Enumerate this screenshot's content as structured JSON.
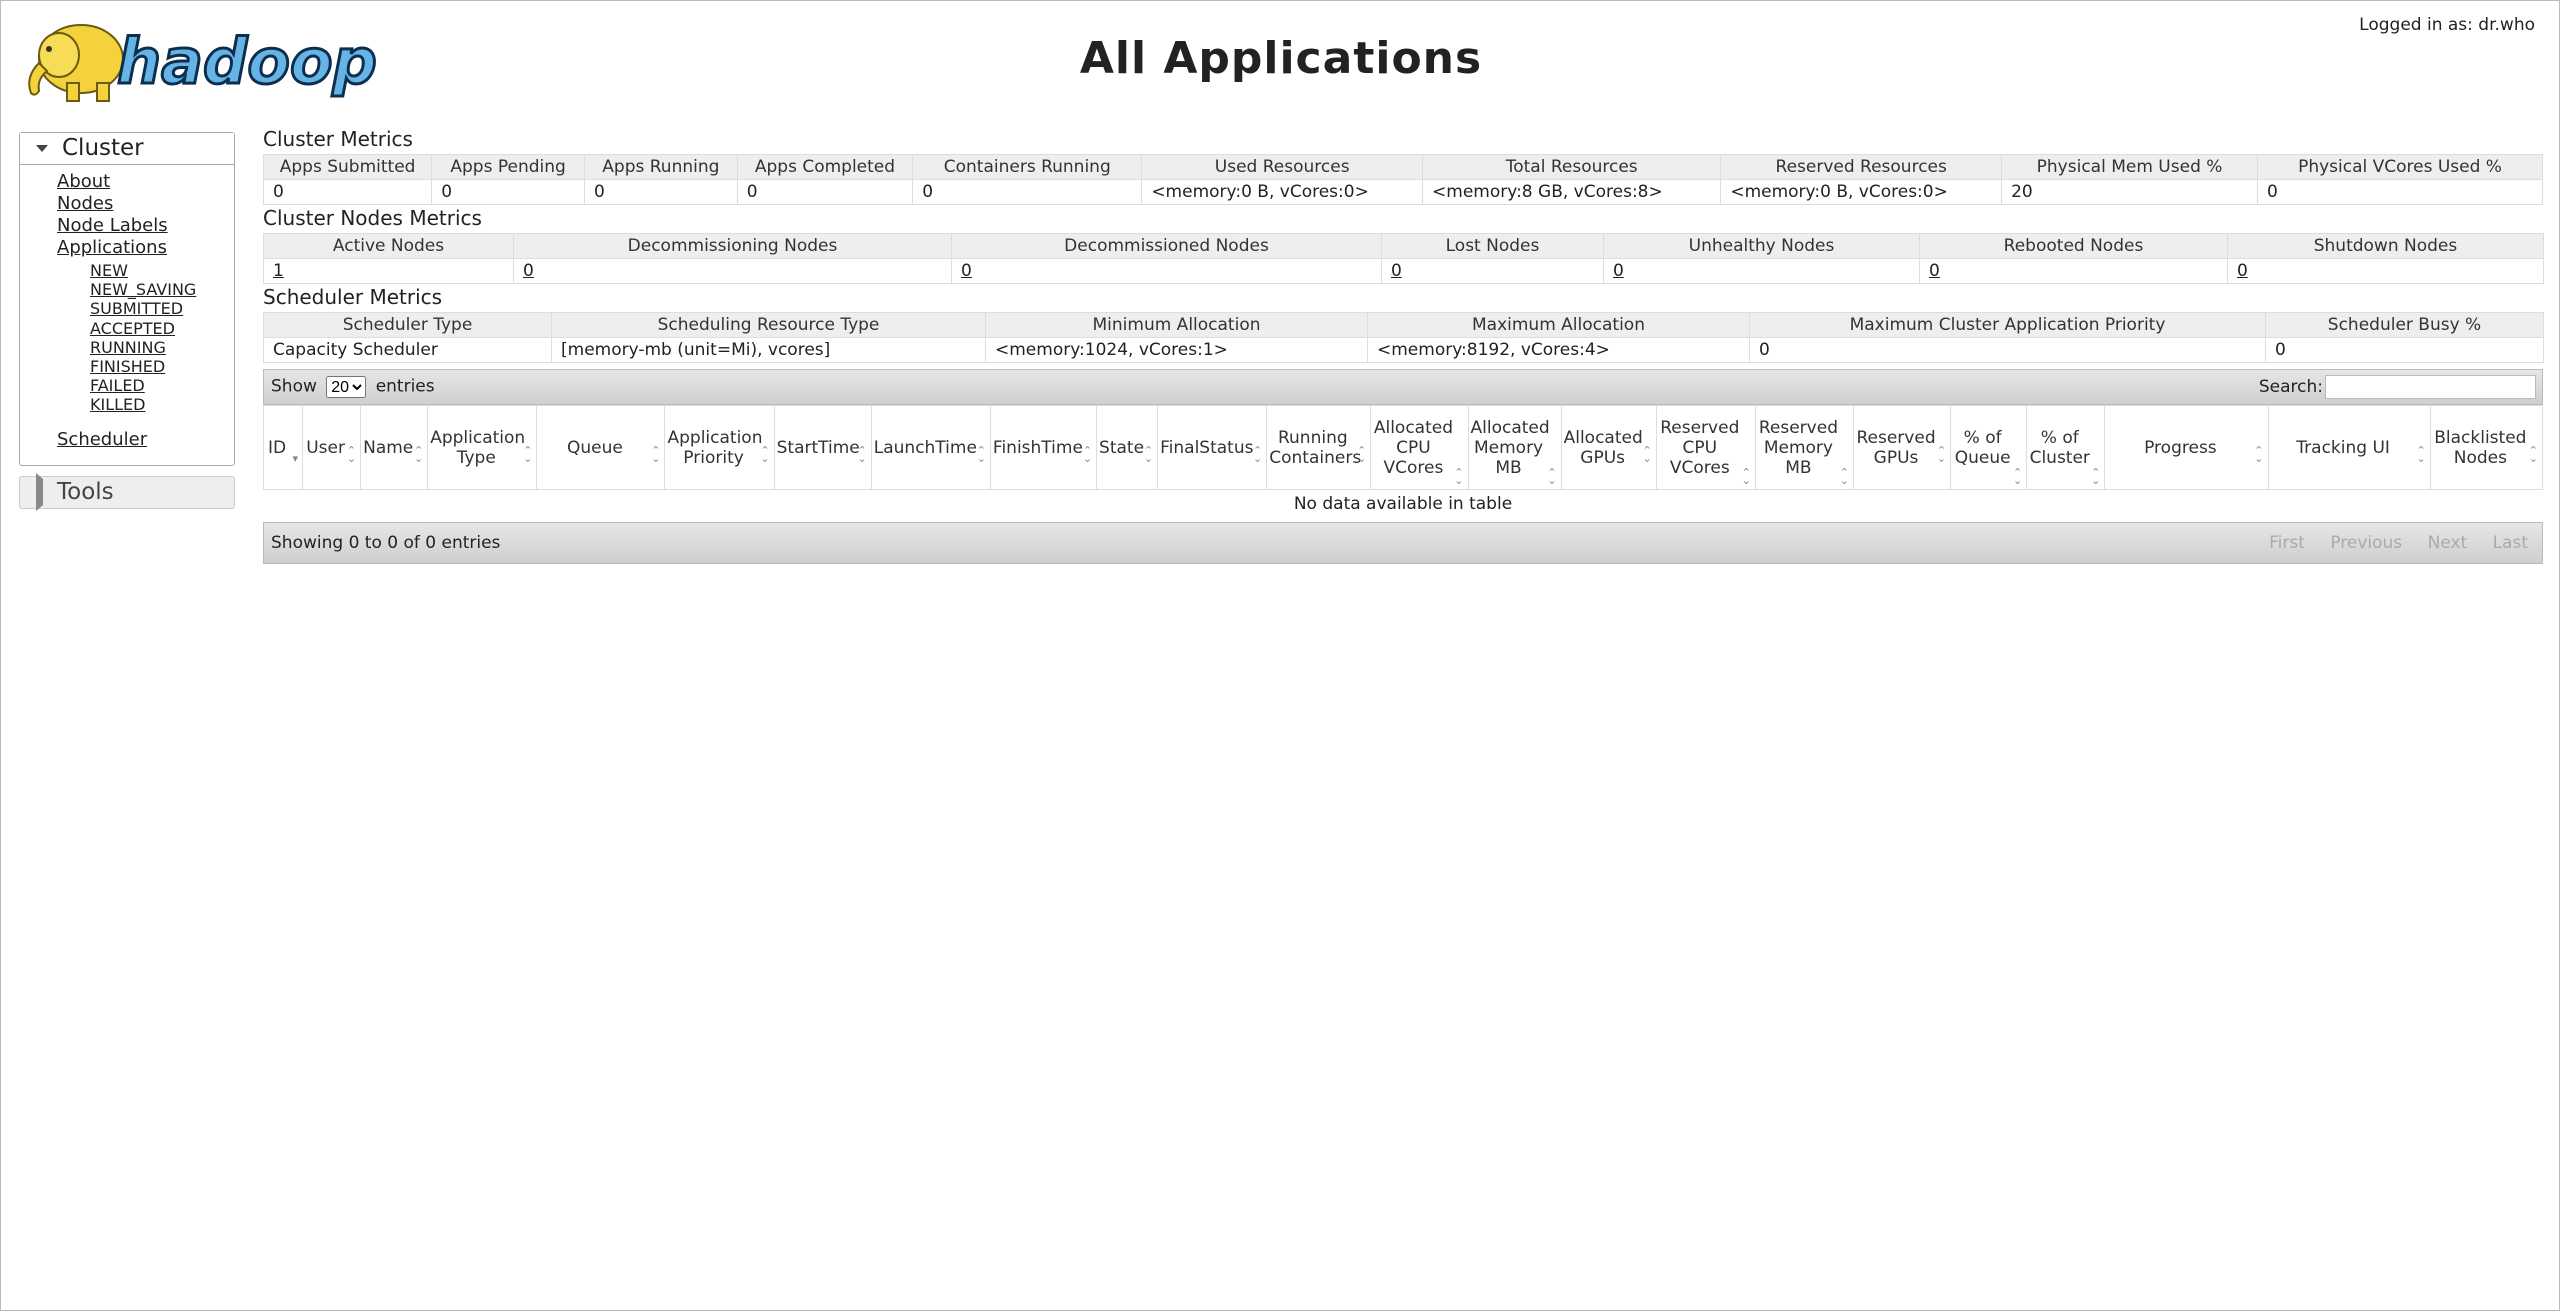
{
  "header": {
    "logo_text": "hadoop",
    "title": "All Applications",
    "logged_in": "Logged in as: dr.who"
  },
  "sidebar": {
    "cluster_label": "Cluster",
    "links": [
      "About",
      "Nodes",
      "Node Labels",
      "Applications"
    ],
    "app_states": [
      "NEW",
      "NEW_SAVING",
      "SUBMITTED",
      "ACCEPTED",
      "RUNNING",
      "FINISHED",
      "FAILED",
      "KILLED"
    ],
    "scheduler": "Scheduler",
    "tools_label": "Tools"
  },
  "cluster_metrics": {
    "title": "Cluster Metrics",
    "headers": [
      "Apps Submitted",
      "Apps Pending",
      "Apps Running",
      "Apps Completed",
      "Containers Running",
      "Used Resources",
      "Total Resources",
      "Reserved Resources",
      "Physical Mem Used %",
      "Physical VCores Used %"
    ],
    "values": [
      "0",
      "0",
      "0",
      "0",
      "0",
      "<memory:0 B, vCores:0>",
      "<memory:8 GB, vCores:8>",
      "<memory:0 B, vCores:0>",
      "20",
      "0"
    ]
  },
  "nodes_metrics": {
    "title": "Cluster Nodes Metrics",
    "headers": [
      "Active Nodes",
      "Decommissioning Nodes",
      "Decommissioned Nodes",
      "Lost Nodes",
      "Unhealthy Nodes",
      "Rebooted Nodes",
      "Shutdown Nodes"
    ],
    "values": [
      "1",
      "0",
      "0",
      "0",
      "0",
      "0",
      "0"
    ]
  },
  "scheduler_metrics": {
    "title": "Scheduler Metrics",
    "headers": [
      "Scheduler Type",
      "Scheduling Resource Type",
      "Minimum Allocation",
      "Maximum Allocation",
      "Maximum Cluster Application Priority",
      "Scheduler Busy %"
    ],
    "values": [
      "Capacity Scheduler",
      "[memory-mb (unit=Mi), vcores]",
      "<memory:1024, vCores:1>",
      "<memory:8192, vCores:4>",
      "0",
      "0"
    ]
  },
  "apps_table": {
    "show_label": "Show",
    "entries_label": "entries",
    "page_size": "20",
    "search_label": "Search:",
    "columns": [
      "ID",
      "User",
      "Name",
      "Application Type",
      "Queue",
      "Application Priority",
      "StartTime",
      "LaunchTime",
      "FinishTime",
      "State",
      "FinalStatus",
      "Running Containers",
      "Allocated CPU VCores",
      "Allocated Memory MB",
      "Allocated GPUs",
      "Reserved CPU VCores",
      "Reserved Memory MB",
      "Reserved GPUs",
      "% of Queue",
      "% of Cluster",
      "Progress",
      "Tracking UI",
      "Blacklisted Nodes"
    ],
    "empty_message": "No data available in table",
    "info": "Showing 0 to 0 of 0 entries",
    "pager": [
      "First",
      "Previous",
      "Next",
      "Last"
    ]
  }
}
